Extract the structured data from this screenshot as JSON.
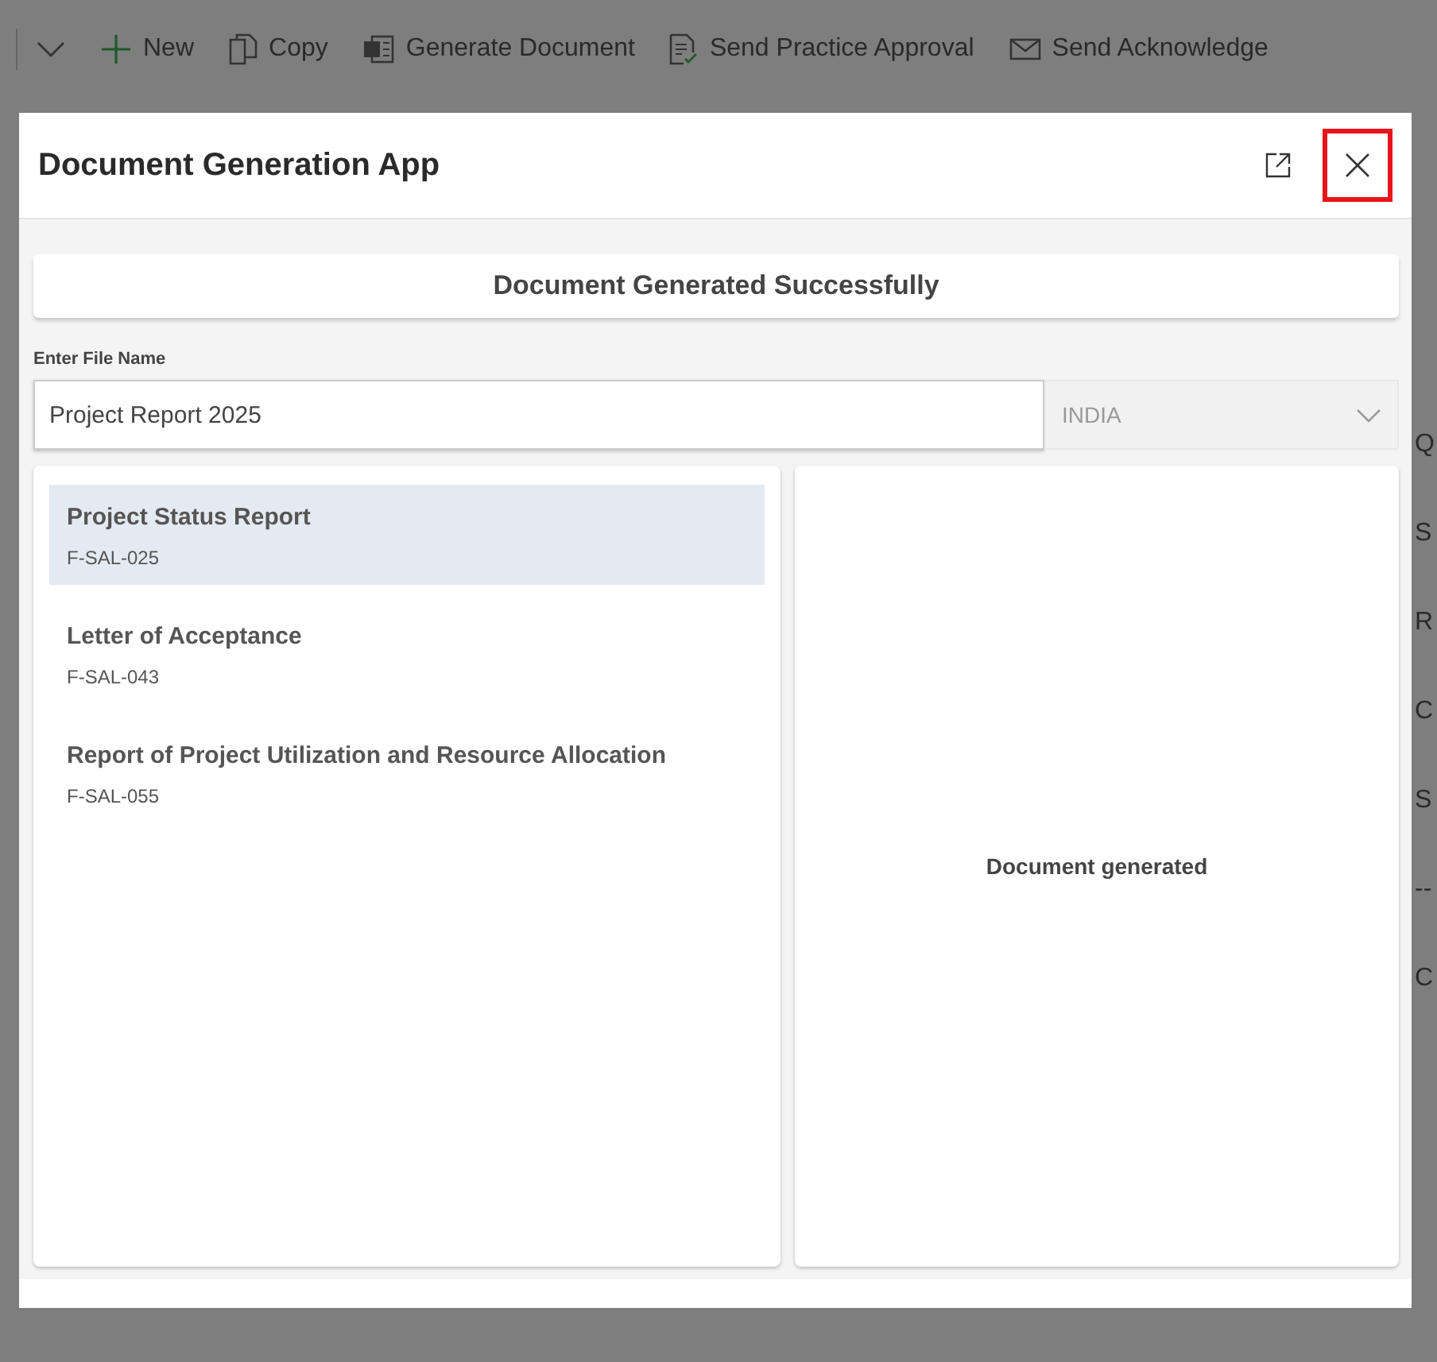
{
  "background": {
    "toolbar": [
      {
        "kind": "chevron"
      },
      {
        "label": "New",
        "kind": "new"
      },
      {
        "label": "Copy",
        "kind": "copy"
      },
      {
        "label": "Generate Document",
        "kind": "word"
      },
      {
        "label": "Send Practice Approval",
        "kind": "approval"
      },
      {
        "label": "Send Acknowledge",
        "kind": "mail"
      }
    ],
    "right_fragments": [
      "Q",
      "S",
      "R",
      "C",
      "S",
      "--",
      "C"
    ]
  },
  "dialog": {
    "title": "Document Generation App",
    "close_highlighted": true,
    "banner": "Document Generated Successfully",
    "file_name": {
      "label": "Enter File Name",
      "value": "Project Report 2025"
    },
    "country": {
      "value": "INDIA",
      "disabled": true
    },
    "templates": [
      {
        "name": "Project Status Report",
        "code": "F-SAL-025",
        "selected": true
      },
      {
        "name": "Letter of Acceptance",
        "code": "F-SAL-043",
        "selected": false
      },
      {
        "name": "Report of Project Utilization and Resource Allocation",
        "code": "F-SAL-055",
        "selected": false
      }
    ],
    "preview_message": "Document generated"
  }
}
